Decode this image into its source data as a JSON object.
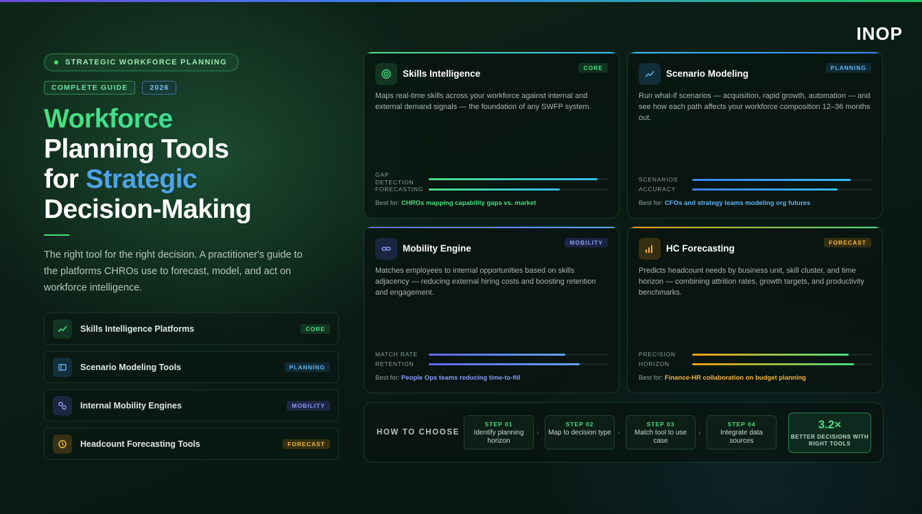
{
  "brand": {
    "logo": "INOP"
  },
  "hero": {
    "eyebrow": "STRATEGIC WORKFORCE PLANNING",
    "tags": [
      "COMPLETE GUIDE",
      "2026"
    ],
    "title_line1": "Workforce",
    "title_line2": "Planning Tools",
    "title_line3_prefix": "for ",
    "title_line3_highlight": "Strategic",
    "title_line4": "Decision-Making",
    "lead": "The right tool for the right decision. A practitioner's guide to the platforms CHROs use to forecast, model, and act on workforce intelligence."
  },
  "tool_list": [
    {
      "label": "Skills Intelligence Platforms",
      "badge": "CORE",
      "icon": "trend-up-icon"
    },
    {
      "label": "Scenario Modeling Tools",
      "badge": "PLANNING",
      "icon": "window-icon"
    },
    {
      "label": "Internal Mobility Engines",
      "badge": "MOBILITY",
      "icon": "link-icon"
    },
    {
      "label": "Headcount Forecasting Tools",
      "badge": "FORECAST",
      "icon": "clock-icon"
    }
  ],
  "cards": [
    {
      "title": "Skills Intelligence",
      "badge": "CORE",
      "icon": "target-icon",
      "desc": "Maps real-time skills across your workforce against internal and external demand signals — the foundation of any SWFP system.",
      "metrics": [
        {
          "label": "GAP DETECTION",
          "value": 0.94
        },
        {
          "label": "FORECASTING",
          "value": 0.73
        }
      ],
      "best_prefix": "Best for: ",
      "best": "CHROs mapping capability gaps vs. market"
    },
    {
      "title": "Scenario Modeling",
      "badge": "PLANNING",
      "icon": "chart-line-icon",
      "desc": "Run what-if scenarios — acquisition, rapid growth, automation — and see how each path affects your workforce composition 12–36 months out.",
      "metrics": [
        {
          "label": "SCENARIOS",
          "value": 0.88
        },
        {
          "label": "ACCURACY",
          "value": 0.81
        }
      ],
      "best_prefix": "Best for: ",
      "best": "CFOs and strategy teams modeling org futures"
    },
    {
      "title": "Mobility Engine",
      "badge": "MOBILITY",
      "icon": "infinity-icon",
      "desc": "Matches employees to internal opportunities based on skills adjacency — reducing external hiring costs and boosting retention and engagement.",
      "metrics": [
        {
          "label": "MATCH RATE",
          "value": 0.76
        },
        {
          "label": "RETENTION",
          "value": 0.84
        }
      ],
      "best_prefix": "Best for: ",
      "best": "People Ops teams reducing time-to-fill"
    },
    {
      "title": "HC Forecasting",
      "badge": "FORECAST",
      "icon": "bar-chart-icon",
      "desc": "Predicts headcount needs by business unit, skill cluster, and time horizon — combining attrition rates, growth targets, and productivity benchmarks.",
      "metrics": [
        {
          "label": "PRECISION",
          "value": 0.87
        },
        {
          "label": "HORIZON",
          "value": 0.9
        }
      ],
      "best_prefix": "Best for: ",
      "best": "Finance-HR collaboration on budget planning"
    }
  ],
  "how_to_choose": {
    "title": "HOW TO CHOOSE",
    "steps": [
      {
        "num": "STEP 01",
        "text": "Identify planning horizon"
      },
      {
        "num": "STEP 02",
        "text": "Map to decision type"
      },
      {
        "num": "STEP 03",
        "text": "Match tool to use case"
      },
      {
        "num": "STEP 04",
        "text": "Integrate data sources"
      }
    ],
    "stat_value": "3.2×",
    "stat_label": "BETTER DECISIONS WITH RIGHT TOOLS"
  },
  "colors": {
    "green": "#4ade80",
    "blue": "#60b4f0",
    "purple": "#8b9cf8",
    "amber": "#f5b640"
  }
}
